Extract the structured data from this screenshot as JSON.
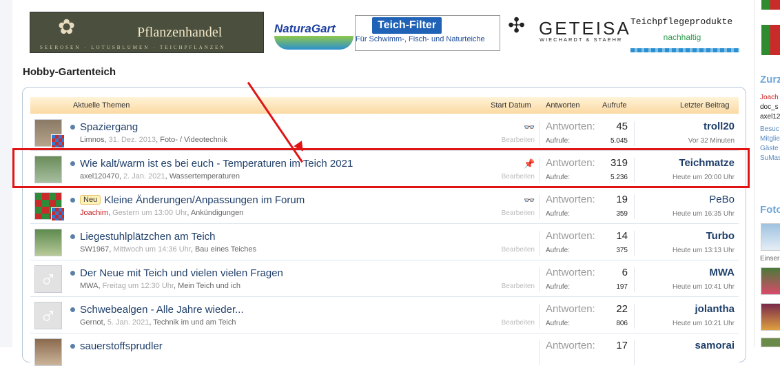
{
  "banners": {
    "pflanzen": {
      "title": "Pflanzenhandel",
      "subtitle": "SEEROSEN · LOTUSBLUMEN · TEICHPFLANZEN"
    },
    "naturagart": "NaturaGart",
    "teichfilter": {
      "title": "Teich-Filter",
      "subtitle": "Für Schwimm-, Fisch- und Naturteiche"
    },
    "geteisa": {
      "title": "GETEISA",
      "subtitle": "WIECHARDT & STAEHR"
    },
    "pflege": {
      "title": "Teichpflegeprodukte",
      "subtitle": "nachhaltig"
    }
  },
  "section_title": "Hobby-Gartenteich",
  "header": {
    "topics": "Aktuelle Themen",
    "start": "Start Datum",
    "replies": "Antworten",
    "views": "Aufrufe",
    "last": "Letzter Beitrag"
  },
  "labels": {
    "replies": "Antworten:",
    "views": "Aufrufe:",
    "edit": "Bearbeiten",
    "new_badge": "Neu"
  },
  "threads": [
    {
      "title": "Spaziergang",
      "author": "Limnos",
      "date": "31. Dez. 2013",
      "forum": "Foto- / Videotechnik",
      "icon": "glasses-icon",
      "replies": "45",
      "views": "5.045",
      "last_user": "troll20",
      "last_time": "Vor 32 Minuten"
    },
    {
      "title": "Wie kalt/warm ist es bei euch - Temperaturen im Teich 2021",
      "author": "axel120470",
      "date": "2. Jan. 2021",
      "forum": "Wassertemperaturen",
      "icon": "pin-icon",
      "replies": "319",
      "views": "5.236",
      "last_user": "Teichmatze",
      "last_time": "Heute um 20:00 Uhr"
    },
    {
      "title": "Kleine Änderungen/Anpassungen im Forum",
      "author": "Joachim",
      "date": "Gestern um 13:00 Uhr",
      "forum": "Ankündigungen",
      "icon": "glasses-icon",
      "replies": "19",
      "views": "359",
      "last_user": "PeBo",
      "last_time": "Heute um 16:35 Uhr"
    },
    {
      "title": "Liegestuhlplätzchen am Teich",
      "author": "SW1967",
      "date": "Mittwoch um 14:36 Uhr",
      "forum": "Bau eines Teiches",
      "icon": "",
      "replies": "14",
      "views": "375",
      "last_user": "Turbo",
      "last_time": "Heute um 13:13 Uhr"
    },
    {
      "title": "Der Neue mit Teich und vielen vielen Fragen",
      "author": "MWA",
      "date": "Freitag um 12:30 Uhr",
      "forum": "Mein Teich und ich",
      "icon": "",
      "replies": "6",
      "views": "197",
      "last_user": "MWA",
      "last_time": "Heute um 10:41 Uhr"
    },
    {
      "title": "Schwebealgen - Alle Jahre wieder...",
      "author": "Gernot",
      "date": "5. Jan. 2021",
      "forum": "Technik im und am Teich",
      "icon": "",
      "replies": "22",
      "views": "806",
      "last_user": "jolantha",
      "last_time": "Heute um 10:21 Uhr"
    },
    {
      "title": "sauerstoffsprudler",
      "last_user": "samorai",
      "replies": "17"
    }
  ],
  "sidebar": {
    "heading1": "Zurz",
    "names": [
      "Joach",
      "doc_s",
      "axel12"
    ],
    "links": [
      "Besuc",
      "Mitglie",
      "Gäste",
      "SuMas"
    ],
    "heading2": "Foto",
    "caption": "Einser"
  },
  "colors": {
    "highlight": "#e01414",
    "link": "#1f3f6a",
    "header_bg": "#fbd9a3"
  }
}
